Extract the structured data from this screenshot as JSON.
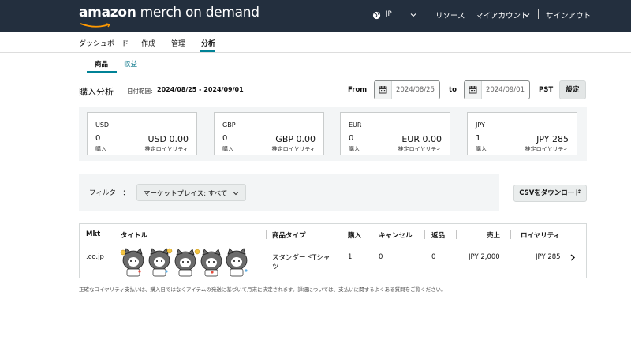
{
  "header": {
    "logo_brand": "amazon",
    "logo_rest": " merch on demand",
    "locale": "JP",
    "links": [
      "リソース",
      "マイアカウント",
      "サインアウト"
    ]
  },
  "nav": {
    "items": [
      "ダッシュボード",
      "作成",
      "管理",
      "分析"
    ],
    "active": "分析"
  },
  "subtabs": [
    "商品",
    "収益"
  ],
  "analysis": {
    "title": "購入分析",
    "range_label": "日付範囲:",
    "range_value": "2024/08/25 - 2024/09/01",
    "from_label": "From",
    "from_value": "2024/08/25",
    "to_label": "to",
    "to_value": "2024/09/01",
    "tz_label": "PST",
    "set_button": "設定"
  },
  "cards": [
    {
      "currency": "USD",
      "count": "0",
      "count_label": "購入",
      "amount": "USD 0.00",
      "amount_label": "推定ロイヤリティ"
    },
    {
      "currency": "GBP",
      "count": "0",
      "count_label": "購入",
      "amount": "GBP 0.00",
      "amount_label": "推定ロイヤリティ"
    },
    {
      "currency": "EUR",
      "count": "0",
      "count_label": "購入",
      "amount": "EUR 0.00",
      "amount_label": "推定ロイヤリティ"
    },
    {
      "currency": "JPY",
      "count": "1",
      "count_label": "購入",
      "amount": "JPY 285",
      "amount_label": "推定ロイヤリティ"
    }
  ],
  "filter": {
    "label": "フィルター：",
    "marketplace": "マーケットプレイス: すべて",
    "csv_button": "CSVをダウンロード"
  },
  "table": {
    "headers": [
      "Mkt",
      "タイトル",
      "商品タイプ",
      "購入",
      "キャンセル",
      "返品",
      "売上",
      "ロイヤリティ"
    ],
    "rows": [
      {
        "mkt": ".co.jp",
        "type_line1": "スタンダードTシャ",
        "type_line2": "ツ",
        "purchases": "1",
        "cancels": "0",
        "returns": "0",
        "sales": "JPY 2,000",
        "royalty": "JPY 285"
      }
    ]
  },
  "footnote": "正確なロイヤリティ支払いは、購入日ではなくアイテムの発送に基づいて月末に決定されます。詳細については、支払いに関するよくある質問をご覧ください。",
  "colors": {
    "header_bg": "#232f3e",
    "accent": "#008296",
    "link": "#007185",
    "smile": "#ff9900"
  }
}
